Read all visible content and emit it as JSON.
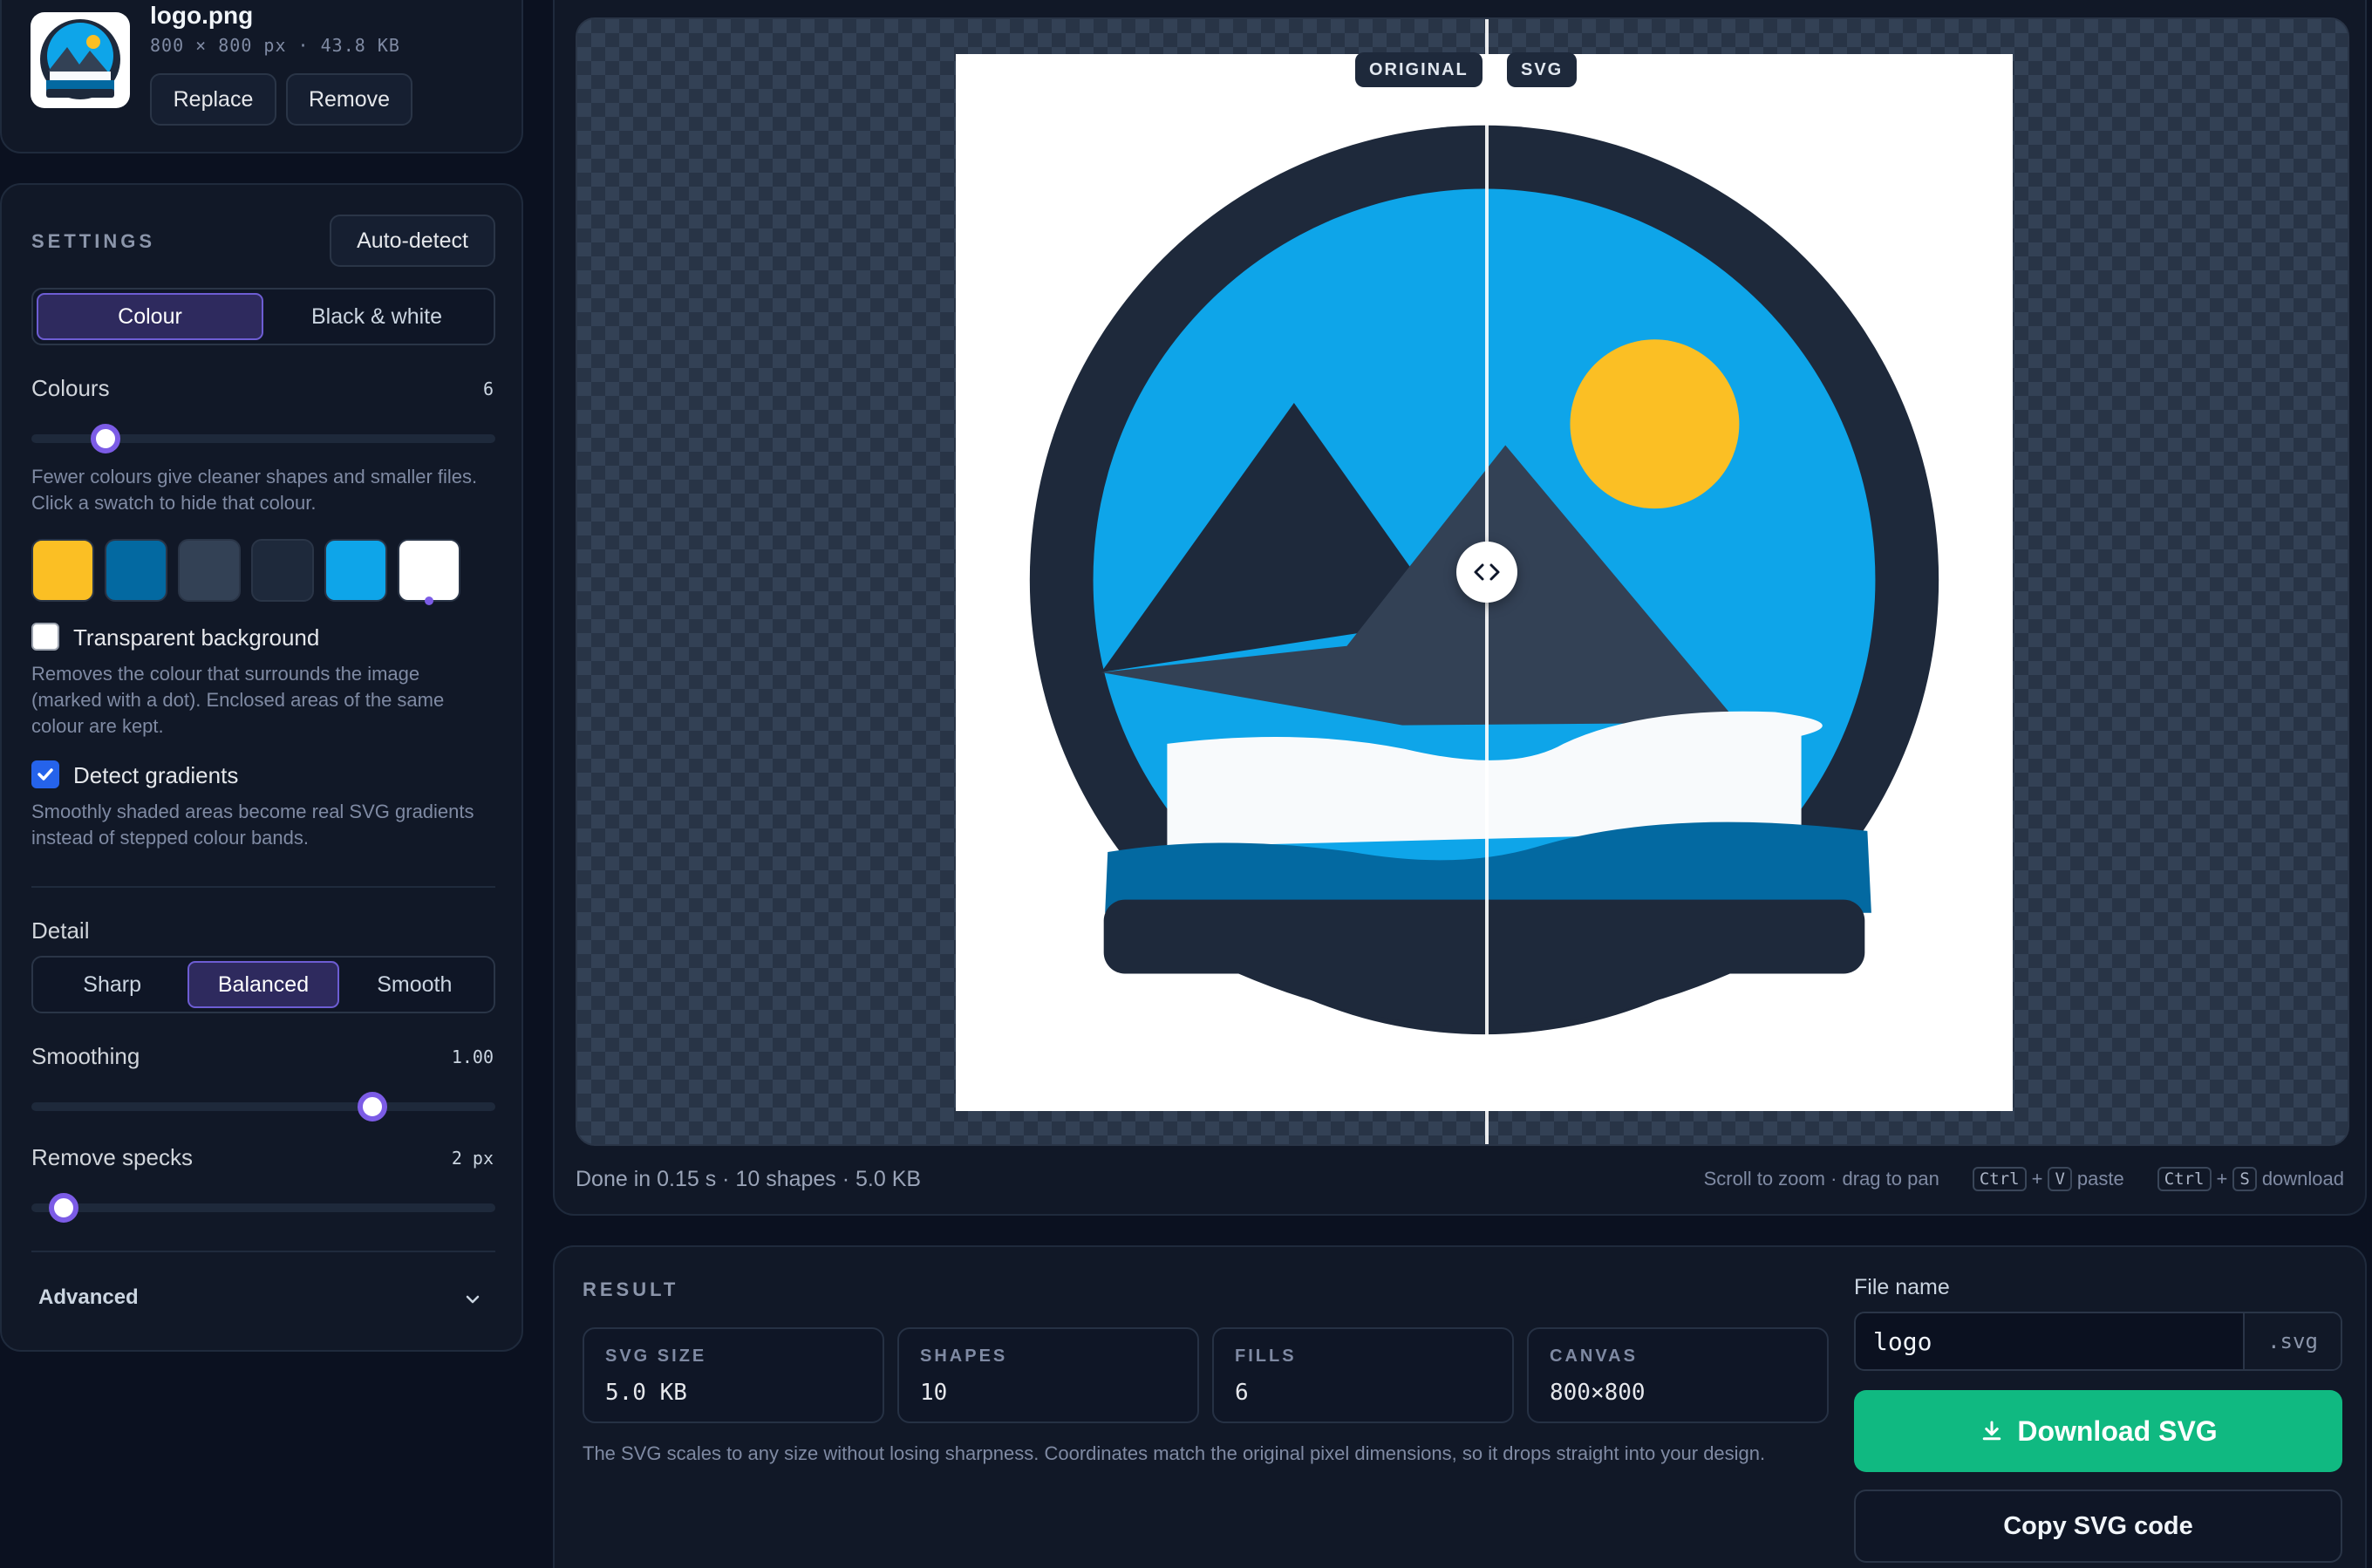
{
  "file": {
    "name": "logo.png",
    "meta": "800 × 800 px · 43.8 KB",
    "replace_label": "Replace",
    "remove_label": "Remove"
  },
  "settings": {
    "section_label": "SETTINGS",
    "autodetect_label": "Auto-detect",
    "mode": {
      "options": [
        "Colour",
        "Black & white"
      ],
      "selected": "Colour"
    },
    "colours": {
      "label": "Colours",
      "value": "6",
      "level": 0.16
    },
    "colours_help": "Fewer colours give cleaner shapes and smaller files. Click a swatch to hide that colour.",
    "swatches": [
      "#fbbf24",
      "#0369a1",
      "#334155",
      "#1e293b",
      "#0ea5e9",
      "#ffffff"
    ],
    "transparent_bg": {
      "label": "Transparent background",
      "checked": false,
      "help": "Removes the colour that surrounds the image (marked with a dot). Enclosed areas of the same colour are kept."
    },
    "gradients": {
      "label": "Detect gradients",
      "checked": true,
      "help": "Smoothly shaded areas become real SVG gradients instead of stepped colour bands."
    },
    "detail": {
      "label": "Detail",
      "options": [
        "Sharp",
        "Balanced",
        "Smooth"
      ],
      "selected": "Balanced"
    },
    "smoothing": {
      "label": "Smoothing",
      "value": "1.00",
      "level": 0.735
    },
    "specks": {
      "label": "Remove specks",
      "value": "2 px",
      "level": 0.07
    },
    "advanced_label": "Advanced"
  },
  "preview": {
    "tag_original": "ORIGINAL",
    "tag_svg": "SVG",
    "status": "Done in 0.15 s · 10 shapes · 5.0 KB",
    "hint_zoom": "Scroll to zoom · drag to pan",
    "hint_paste_keys": [
      "Ctrl",
      "V"
    ],
    "hint_paste": "paste",
    "hint_download_keys": [
      "Ctrl",
      "S"
    ],
    "hint_download": "download",
    "compare_position": 0.5
  },
  "result": {
    "section_label": "RESULT",
    "stats": [
      {
        "label": "SVG SIZE",
        "value": "5.0 KB"
      },
      {
        "label": "SHAPES",
        "value": "10"
      },
      {
        "label": "FILLS",
        "value": "6"
      },
      {
        "label": "CANVAS",
        "value": "800×800"
      }
    ],
    "note": "The SVG scales to any size without losing sharpness. Coordinates match the original pixel dimensions, so it drops straight into your design.",
    "filename_label": "File name",
    "filename_value": "logo",
    "filename_ext": ".svg",
    "download_label": "Download SVG",
    "copy_label": "Copy SVG code"
  },
  "colors": {
    "accent": "#7c5ce6",
    "download": "#10b981",
    "sun": "#fbbf24",
    "sky": "#0ea5e9",
    "navy": "#1e293b"
  }
}
